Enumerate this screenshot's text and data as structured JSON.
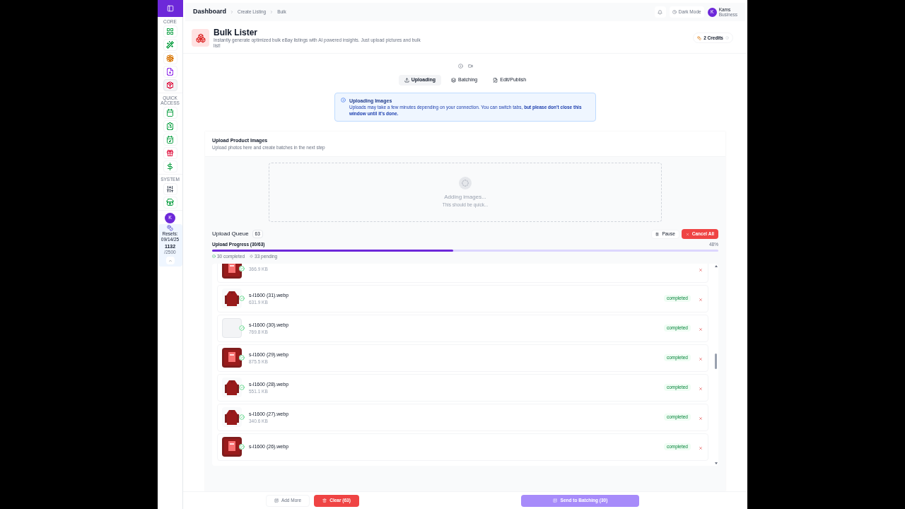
{
  "sidebar": {
    "sections": [
      {
        "label": "CORE",
        "items": [
          {
            "kind": "grid",
            "color": "#16a34a",
            "selected": false
          },
          {
            "kind": "wand",
            "color": "#16a34a",
            "selected": false
          },
          {
            "kind": "target",
            "color": "#d97706",
            "selected": false
          },
          {
            "kind": "file",
            "color": "#9333ea",
            "selected": false
          },
          {
            "kind": "package",
            "color": "#e11d48",
            "selected": true
          }
        ]
      },
      {
        "label": "QUICK ACCESS",
        "items": [
          {
            "kind": "calendar",
            "color": "#16a34a",
            "selected": false
          },
          {
            "kind": "clipboard",
            "color": "#16a34a",
            "selected": false
          },
          {
            "kind": "check",
            "color": "#16a34a",
            "selected": false
          },
          {
            "kind": "gift",
            "color": "#e11d48",
            "selected": false
          },
          {
            "kind": "dollar",
            "color": "#16a34a",
            "selected": false
          }
        ]
      },
      {
        "label": "SYSTEM",
        "items": [
          {
            "kind": "sliders",
            "color": "#374151",
            "selected": false
          },
          {
            "kind": "store",
            "color": "#16a34a",
            "selected": false
          }
        ]
      }
    ],
    "usage": {
      "avatar": "K",
      "resets_label": "Resets:",
      "resets_date": "09/14/25",
      "count": "1132",
      "limit": "/2500"
    }
  },
  "topbar": {
    "title": "Dashboard",
    "breadcrumbs": [
      "Create Listing",
      "Bulk"
    ],
    "theme_button": "Dark Mode",
    "user": {
      "avatar": "K",
      "name": "Kams",
      "plan": "Business"
    }
  },
  "page": {
    "title": "Bulk Lister",
    "description": "Instantly generate optimized bulk eBay listings with AI powered insights. Just upload pictures and bulk list!",
    "credits": "2 Credits"
  },
  "tabs": [
    {
      "label": "Uploading",
      "kind": "upload",
      "selected": true
    },
    {
      "label": "Batching",
      "kind": "batch",
      "selected": false
    },
    {
      "label": "Edit/Publish",
      "kind": "edit",
      "selected": false
    }
  ],
  "alert": {
    "title": "Uploading Images",
    "text": "Uploads may take a few minutes depending on your connection. You can switch tabs, **but please don't close this window until it's done.**"
  },
  "upload_card": {
    "title": "Upload Product Images",
    "subtitle": "Upload photos here and create batches in the next step",
    "dropzone": {
      "title": "Adding images...",
      "subtitle": "This should be quick..."
    }
  },
  "queue": {
    "title": "Upload Queue",
    "count": "63",
    "pause": "Pause",
    "cancel": "Cancel All",
    "progress_label": "Upload Progress (30/63)",
    "percent": "48%",
    "level": 0.476,
    "completed": "30 completed",
    "pending": "33 pending",
    "files": [
      {
        "size": "366.9 KB",
        "kind": "picture",
        "done": true
      },
      {
        "name": "s-l1600 (31).webp",
        "size": "631.9 KB",
        "status": "completed",
        "kind": "picture",
        "done": true
      },
      {
        "name": "s-l1600 (30).webp",
        "size": "769.8 KB",
        "status": "completed",
        "kind": "placeholder",
        "done": true
      },
      {
        "name": "s-l1600 (29).webp",
        "size": "875.5 KB",
        "status": "completed",
        "kind": "picture",
        "done": true
      },
      {
        "name": "s-l1600 (28).webp",
        "size": "551.1 KB",
        "status": "completed",
        "kind": "picture",
        "done": true
      },
      {
        "name": "s-l1600 (27).webp",
        "size": "340.6 KB",
        "status": "completed",
        "kind": "picture",
        "done": true
      },
      {
        "name": "s-l1600 (26).webp",
        "status": "completed",
        "kind": "picture",
        "done": true
      }
    ]
  },
  "footer": {
    "add_more": "Add More",
    "clear": "Clear (63)",
    "send": "Send to Batching (30)"
  }
}
